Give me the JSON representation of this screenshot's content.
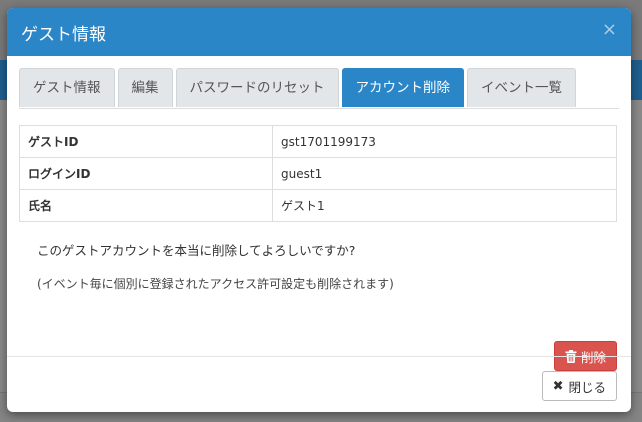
{
  "modal": {
    "title": "ゲスト情報",
    "close_glyph": "×"
  },
  "tabs": [
    {
      "label": "ゲスト情報",
      "active": false
    },
    {
      "label": "編集",
      "active": false
    },
    {
      "label": "パスワードのリセット",
      "active": false
    },
    {
      "label": "アカウント削除",
      "active": true
    },
    {
      "label": "イベント一覧",
      "active": false
    }
  ],
  "info": {
    "rows": [
      {
        "key": "ゲストID",
        "value": "gst1701199173"
      },
      {
        "key": "ログインID",
        "value": "guest1"
      },
      {
        "key": "氏名",
        "value": "ゲスト1"
      }
    ]
  },
  "messages": {
    "confirm": "このゲストアカウントを本当に削除してよろしいですか?",
    "note": "(イベント毎に個別に登録されたアクセス許可設定も削除されます)"
  },
  "buttons": {
    "delete_label": "削除",
    "close_label": "閉じる",
    "close_glyph": "✖"
  },
  "colors": {
    "primary": "#2b86c8",
    "danger": "#d9534f"
  },
  "icons": {
    "delete": "trash-icon",
    "close": "x-icon"
  }
}
